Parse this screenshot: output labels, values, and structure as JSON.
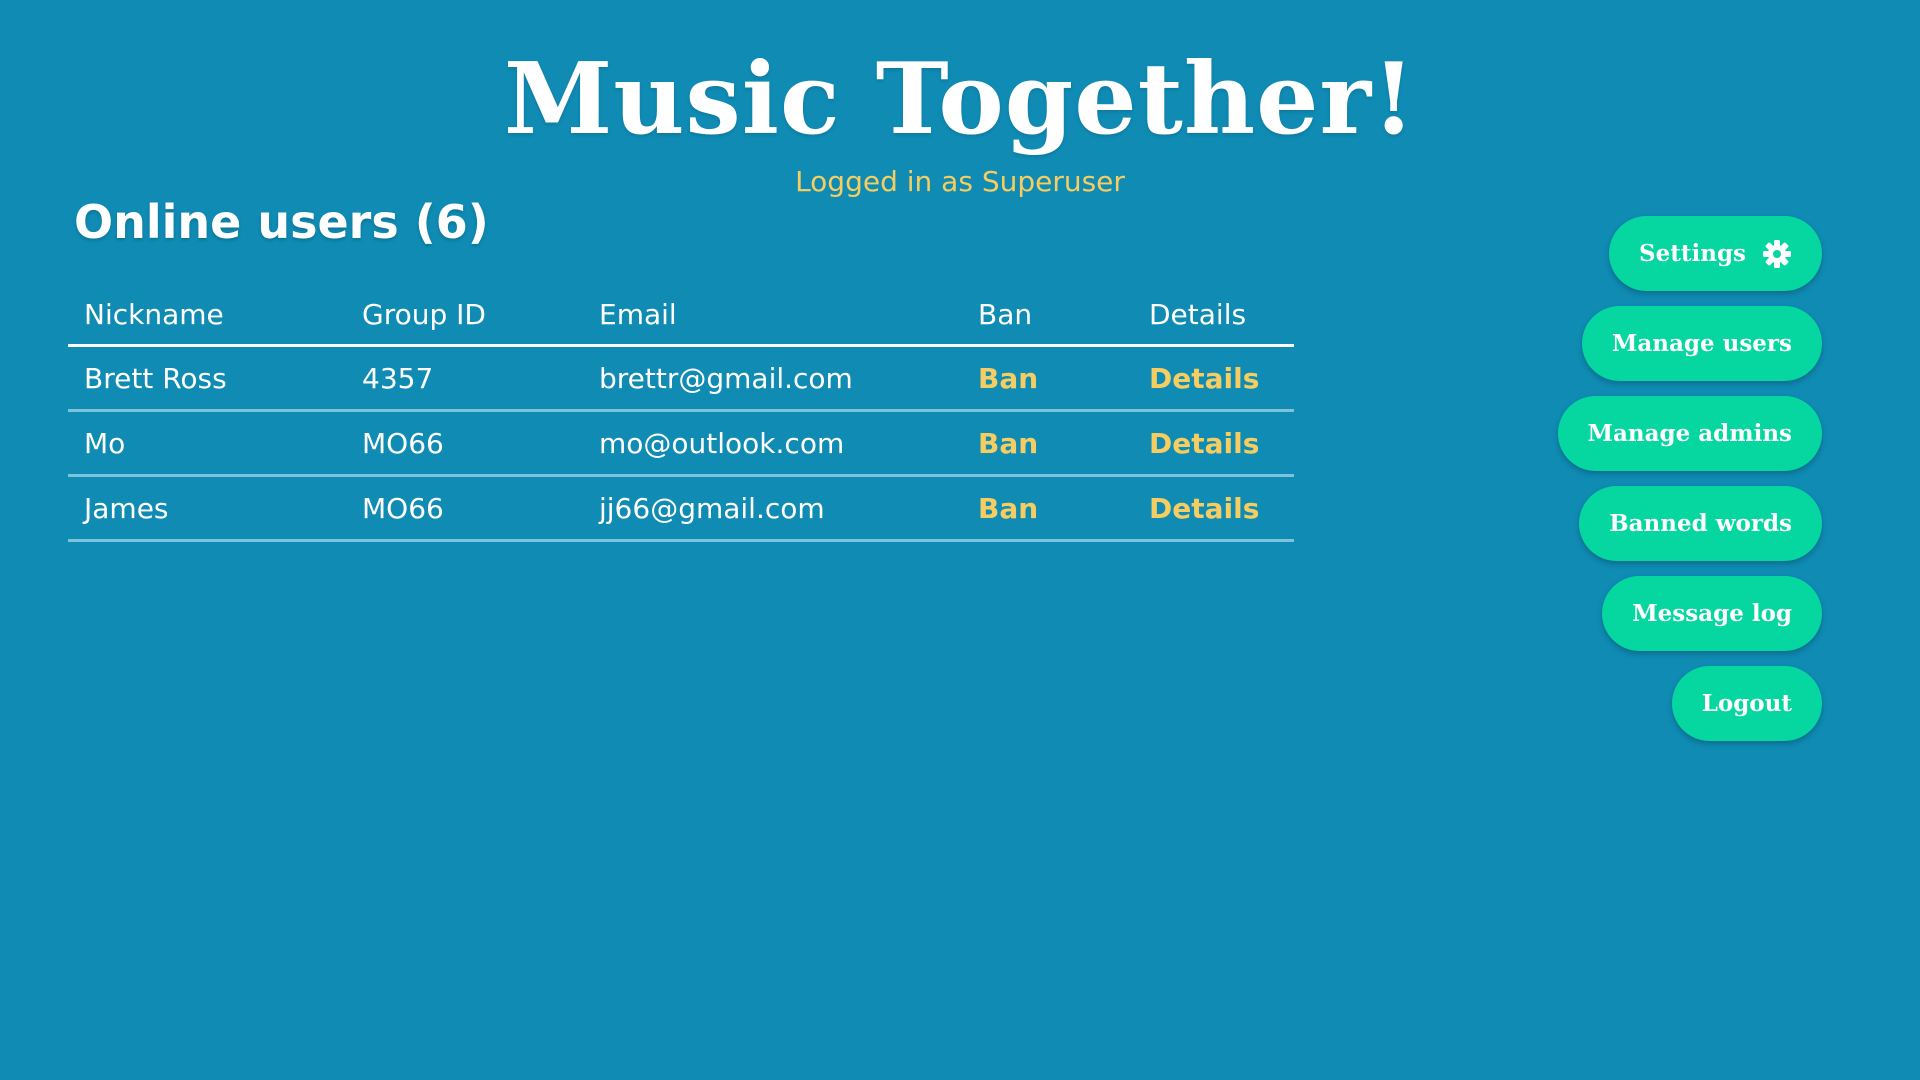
{
  "header": {
    "title": "Music Together!",
    "logged_in_text": "Logged in as Superuser"
  },
  "online_users": {
    "title": "Online users (6)",
    "columns": [
      "Nickname",
      "Group ID",
      "Email",
      "Ban",
      "Details"
    ],
    "rows": [
      {
        "nickname": "Brett Ross",
        "group_id": "4357",
        "email": "brettr@gmail.com",
        "ban": "Ban",
        "details": "Details"
      },
      {
        "nickname": "Mo",
        "group_id": "MO66",
        "email": "mo@outlook.com",
        "ban": "Ban",
        "details": "Details"
      },
      {
        "nickname": "James",
        "group_id": "MO66",
        "email": "jj66@gmail.com",
        "ban": "Ban",
        "details": "Details"
      }
    ]
  },
  "sidebar": {
    "buttons": [
      {
        "label": "Settings",
        "icon": "gear-icon"
      },
      {
        "label": "Manage users"
      },
      {
        "label": "Manage admins"
      },
      {
        "label": "Banned words"
      },
      {
        "label": "Message log"
      },
      {
        "label": "Logout"
      }
    ]
  },
  "colors": {
    "background": "#0f8bb4",
    "accent_text": "#f6cd61",
    "button": "#06d6a0",
    "text": "#ffffff"
  }
}
